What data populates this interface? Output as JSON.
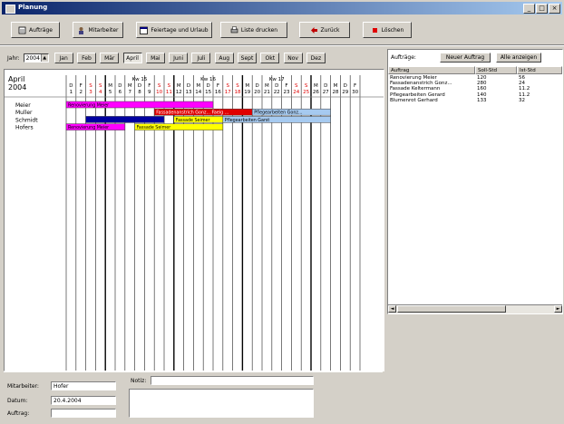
{
  "window": {
    "title": "Planung"
  },
  "toolbar": {
    "buttons": [
      {
        "label": "Aufträge"
      },
      {
        "label": "Mitarbeiter"
      },
      {
        "label": "Feiertage und Urlaub"
      },
      {
        "label": "Liste drucken"
      },
      {
        "label": "Zurück"
      },
      {
        "label": "Löschen"
      }
    ]
  },
  "months": {
    "year_label": "Jahr:",
    "year_value": "2004",
    "items": [
      "Jan",
      "Feb",
      "Mär",
      "April",
      "Mai",
      "Juni",
      "Juli",
      "Aug",
      "Sept",
      "Okt",
      "Nov",
      "Dez"
    ],
    "active_index": 3
  },
  "gantt": {
    "month_title": "April",
    "year_title": "2004",
    "weeks": [
      "Kw 15",
      "Kw 16",
      "Kw 17"
    ],
    "weekday_letters": [
      "D",
      "F",
      "S",
      "S",
      "M",
      "D",
      "M",
      "D",
      "F",
      "S",
      "S",
      "M",
      "D",
      "M",
      "D",
      "F",
      "S",
      "S",
      "M",
      "D",
      "M",
      "D",
      "F",
      "S",
      "S",
      "M",
      "D",
      "M",
      "D",
      "F"
    ],
    "days": [
      1,
      2,
      3,
      4,
      5,
      6,
      7,
      8,
      9,
      10,
      11,
      12,
      13,
      14,
      15,
      16,
      17,
      18,
      19,
      20,
      21,
      22,
      23,
      24,
      25,
      26,
      27,
      28,
      29,
      30
    ],
    "weekend_color": "#e00000",
    "employees": [
      "Meier",
      "Muller",
      "Schmidt",
      "Hofers"
    ],
    "bars": [
      {
        "row": 0,
        "start": 1,
        "end": 15,
        "color": "#ff00ff",
        "label": "Renovierung Meier"
      },
      {
        "row": 1,
        "start": 10,
        "end": 19,
        "color": "#e00000",
        "label": "Fassadenanstrich Gonz... Faeig ..."
      },
      {
        "row": 1,
        "start": 20,
        "end": 27,
        "color": "#a6caf0",
        "label": "Pflegearbeiten Gonz..."
      },
      {
        "row": 2,
        "start": 3,
        "end": 10,
        "color": "#0000a0",
        "label": ""
      },
      {
        "row": 2,
        "start": 12,
        "end": 16,
        "color": "#ffff00",
        "label": "Fassade Seimer"
      },
      {
        "row": 2,
        "start": 17,
        "end": 27,
        "color": "#a6caf0",
        "label": "Pflegearbeiten Garst"
      },
      {
        "row": 3,
        "start": 1,
        "end": 6,
        "color": "#ff00ff",
        "label": "Renovierung Meier"
      },
      {
        "row": 3,
        "start": 8,
        "end": 16,
        "color": "#ffff00",
        "label": "Fassade Seimer"
      }
    ]
  },
  "orders": {
    "label": "Aufträge:",
    "new_button": "Neuer Auftrag",
    "all_button": "Alle anzeigen",
    "columns": [
      "Auftrag",
      "Soll-Std",
      "Ist-Std"
    ],
    "rows": [
      [
        "Renovierung Meier",
        "120",
        "56"
      ],
      [
        "Fassadenanstrich Gonz...",
        "280",
        "24"
      ],
      [
        "Fassade Keltermann",
        "160",
        "11.2"
      ],
      [
        "Pflegearbeiten Gerard",
        "140",
        "11.2"
      ],
      [
        "Blumenrot Gerhard",
        "133",
        "32"
      ]
    ]
  },
  "details": {
    "employee_label": "Mitarbeiter:",
    "employee_value": "Hofer",
    "date_label": "Datum:",
    "date_value": "20.4.2004",
    "order_label": "Auftrag:",
    "order_value": "",
    "note_label": "Notiz:",
    "note_value": ""
  }
}
